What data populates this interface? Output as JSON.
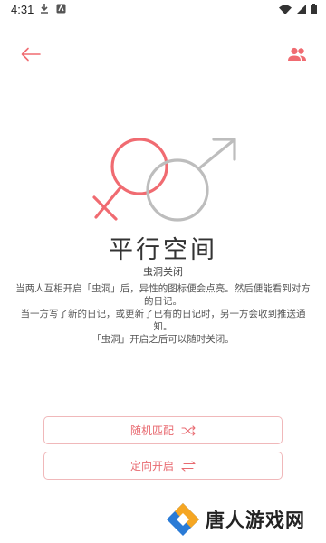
{
  "status_bar": {
    "time": "4:31",
    "icons_left": [
      "download-icon",
      "android-app-icon"
    ],
    "icons_right": [
      "wifi-icon",
      "signal-icon",
      "battery-icon"
    ]
  },
  "toolbar": {
    "back_icon": "arrow-left-icon",
    "right_icon": "people-icon",
    "accent_color": "#f06b71"
  },
  "hero": {
    "icon": "female-male-symbols",
    "female_color": "#f06b71",
    "male_color": "#bdbdbd"
  },
  "title": "平行空间",
  "subtitle": "虫洞关闭",
  "description": [
    "当两人互相开启「虫洞」后，异性的图标便会点亮。然后便能看到对方的日记。",
    "当一方写了新的日记，或更新了已有的日记时，另一方会收到推送通知。",
    "「虫洞」开启之后可以随时关闭。"
  ],
  "buttons": {
    "random_match": {
      "label": "随机匹配",
      "icon": "shuffle-icon"
    },
    "directed_open": {
      "label": "定向开启",
      "icon": "swap-arrows-icon"
    }
  },
  "watermark": {
    "text": "唐人游戏网",
    "logo": "tangren-logo-icon"
  }
}
